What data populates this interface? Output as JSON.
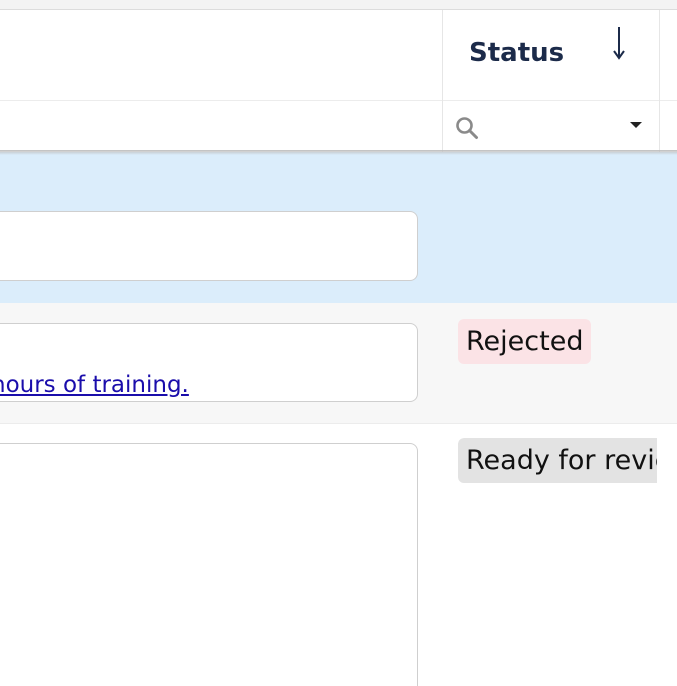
{
  "table": {
    "columns": {
      "status": {
        "header": "Status",
        "sort_direction": "descending",
        "filter_placeholder": ""
      }
    },
    "rows": [
      {
        "state": "selected",
        "text_snippet": "",
        "status": ""
      },
      {
        "state": "normal",
        "text_snippet": "hours of training.",
        "status": "Rejected",
        "status_color": "#fbe3e6"
      },
      {
        "state": "normal",
        "text_snippet": "",
        "status": "Ready for revie",
        "status_color": "#e3e3e3"
      }
    ]
  },
  "colors": {
    "header_text": "#1c2b4a",
    "selected_row": "#dbedfb",
    "link": "#1a0dab"
  },
  "icons": {
    "sort": "arrow-down-icon",
    "filter": "search-icon",
    "dropdown": "caret-down-icon"
  }
}
